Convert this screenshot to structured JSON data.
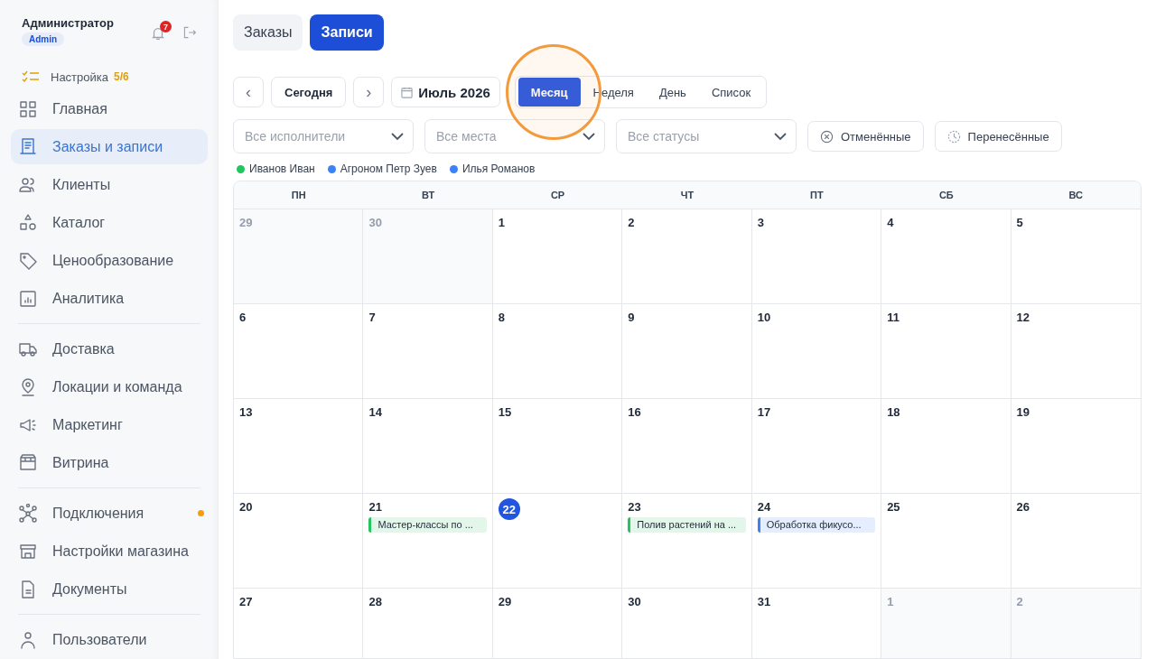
{
  "user": {
    "name": "Администратор",
    "role": "Admin",
    "notifications": "7"
  },
  "setup": {
    "label": "Настройка",
    "progress": "5/6"
  },
  "sidebar": {
    "groups": [
      [
        {
          "label": "Главная",
          "selected": false
        },
        {
          "label": "Заказы и записи",
          "selected": true
        },
        {
          "label": "Клиенты",
          "selected": false
        },
        {
          "label": "Каталог",
          "selected": false
        },
        {
          "label": "Ценообразование",
          "selected": false
        },
        {
          "label": "Аналитика",
          "selected": false
        }
      ],
      [
        {
          "label": "Доставка",
          "selected": false
        },
        {
          "label": "Локации и команда",
          "selected": false
        },
        {
          "label": "Маркетинг",
          "selected": false
        },
        {
          "label": "Витрина",
          "selected": false
        }
      ],
      [
        {
          "label": "Подключения",
          "selected": false,
          "color": "#f59e0b"
        },
        {
          "label": "Настройки магазина",
          "selected": false
        },
        {
          "label": "Документы",
          "selected": false
        }
      ],
      [
        {
          "label": "Пользователи",
          "selected": false
        }
      ]
    ]
  },
  "tabs": [
    {
      "label": "Заказы",
      "selected": false
    },
    {
      "label": "Записи",
      "selected": true
    }
  ],
  "toolbar": {
    "prev": "‹",
    "today": "Сегодня",
    "next": "›",
    "month": "Июль 2026",
    "views": [
      {
        "label": "Месяц",
        "selected": true
      },
      {
        "label": "Неделя",
        "selected": false
      },
      {
        "label": "День",
        "selected": false
      },
      {
        "label": "Список",
        "selected": false
      }
    ]
  },
  "filters": [
    {
      "placeholder": "Все исполнители"
    },
    {
      "placeholder": "Все места"
    },
    {
      "placeholder": "Все статусы"
    }
  ],
  "toggles": [
    {
      "label": "Отменённые"
    },
    {
      "label": "Перенесённые"
    }
  ],
  "legend": [
    {
      "name": "Иванов Иван",
      "color": "#22c55e"
    },
    {
      "name": "Агроном Петр Зуев",
      "color": "#3b82f6"
    },
    {
      "name": "Илья Романов",
      "color": "#3b82f6"
    }
  ],
  "calendar": {
    "weekdays": [
      "ПН",
      "ВТ",
      "СР",
      "ЧТ",
      "ПТ",
      "СБ",
      "ВС"
    ],
    "weeks": [
      [
        {
          "day": "29",
          "muted": true
        },
        {
          "day": "30",
          "muted": true
        },
        {
          "day": "1"
        },
        {
          "day": "2"
        },
        {
          "day": "3"
        },
        {
          "day": "4"
        },
        {
          "day": "5"
        }
      ],
      [
        {
          "day": "6"
        },
        {
          "day": "7"
        },
        {
          "day": "8"
        },
        {
          "day": "9"
        },
        {
          "day": "10"
        },
        {
          "day": "11"
        },
        {
          "day": "12"
        }
      ],
      [
        {
          "day": "13"
        },
        {
          "day": "14"
        },
        {
          "day": "15"
        },
        {
          "day": "16"
        },
        {
          "day": "17"
        },
        {
          "day": "18"
        },
        {
          "day": "19"
        }
      ],
      [
        {
          "day": "20"
        },
        {
          "day": "21",
          "events": [
            {
              "title": "Мастер-классы по ...",
              "color": "#22c55e"
            }
          ]
        },
        {
          "day": "22",
          "today": true
        },
        {
          "day": "23",
          "events": [
            {
              "title": "Полив растений на ...",
              "color": "#22c55e"
            }
          ]
        },
        {
          "day": "24",
          "events": [
            {
              "title": "Обработка фикусо...",
              "color": "#3b82f6"
            }
          ]
        },
        {
          "day": "25"
        },
        {
          "day": "26"
        }
      ],
      [
        {
          "day": "27"
        },
        {
          "day": "28"
        },
        {
          "day": "29"
        },
        {
          "day": "30"
        },
        {
          "day": "31"
        },
        {
          "day": "1",
          "muted": true
        },
        {
          "day": "2",
          "muted": true
        }
      ]
    ]
  }
}
